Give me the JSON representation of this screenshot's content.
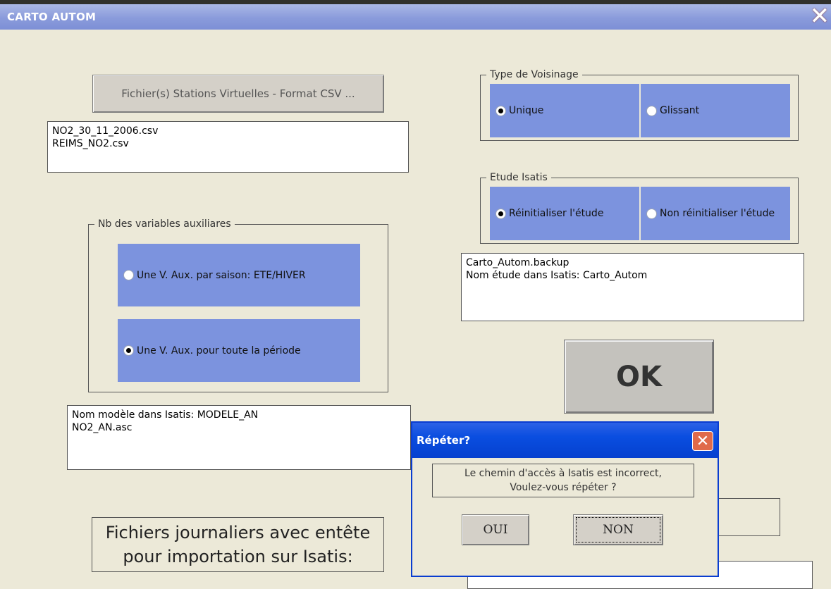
{
  "window": {
    "title": "CARTO AUTOM",
    "close_glyph": "✕"
  },
  "file_button": {
    "label": "Fichier(s) Stations Virtuelles - Format CSV ..."
  },
  "file_list": {
    "lines": [
      "NO2_30_11_2006.csv",
      "REIMS_NO2.csv"
    ]
  },
  "voisinage": {
    "legend": "Type de Voisinage",
    "options": [
      {
        "label": "Unique",
        "selected": true
      },
      {
        "label": "Glissant",
        "selected": false
      }
    ]
  },
  "etude": {
    "legend": "Etude Isatis",
    "options": [
      {
        "label": "Réinitialiser l'étude",
        "selected": true
      },
      {
        "label": "Non réinitialiser l'étude",
        "selected": false
      }
    ]
  },
  "backup_box": {
    "lines": [
      "Carto_Autom.backup",
      "Nom étude dans Isatis: Carto_Autom"
    ]
  },
  "variables": {
    "legend": "Nb des variables auxiliares",
    "options": [
      {
        "label": "Une V. Aux. par saison: ETE/HIVER",
        "selected": false
      },
      {
        "label": "Une V. Aux. pour toute la période",
        "selected": true
      }
    ]
  },
  "model_box": {
    "lines": [
      "Nom modèle dans Isatis: MODELE_AN",
      "NO2_AN.asc"
    ]
  },
  "ok_button": {
    "label": "OK"
  },
  "journaliers_label": {
    "lines": [
      "Fichiers journaliers avec entête",
      "pour importation sur Isatis:"
    ]
  },
  "dialog": {
    "title": "Répéter?",
    "close_glyph": "✕",
    "message_lines": [
      "Le chemin d'accès à Isatis est incorrect,",
      "Voulez-vous répéter ?"
    ],
    "yes_label": "OUI",
    "no_label": "NON"
  },
  "colors": {
    "option_bg": "#7c93de",
    "title_bar": "#8a9bdb",
    "dialog_title": "#0a4ee0",
    "window_bg": "#ece9d8"
  }
}
